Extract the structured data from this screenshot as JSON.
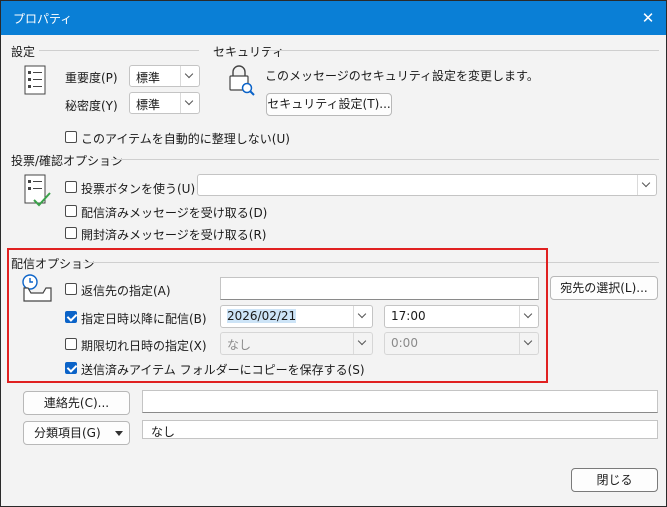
{
  "window": {
    "title": "プロパティ",
    "close_glyph": "✕"
  },
  "settings": {
    "heading": "設定",
    "importance_label": "重要度(P)",
    "importance_value": "標準",
    "sensitivity_label": "秘密度(Y)",
    "sensitivity_value": "標準",
    "do_not_autoarchive": "このアイテムを自動的に整理しない(U)"
  },
  "security": {
    "heading": "セキュリティ",
    "description": "このメッセージのセキュリティ設定を変更します。",
    "button": "セキュリティ設定(T)..."
  },
  "voting": {
    "heading": "投票/確認オプション",
    "use_voting": "投票ボタンを使う(U)",
    "voting_value": "",
    "delivery_receipt": "配信済みメッセージを受け取る(D)",
    "read_receipt": "開封済みメッセージを受け取る(R)"
  },
  "delivery": {
    "heading": "配信オプション",
    "reply_to_label": "返信先の指定(A)",
    "reply_to_value": "",
    "select_names_button": "宛先の選択(L)...",
    "do_not_deliver_label": "指定日時以降に配信(B)",
    "deliver_date": "2026/02/21",
    "deliver_time": "17:00",
    "expires_label": "期限切れ日時の指定(X)",
    "expires_date": "なし",
    "expires_time": "0:00",
    "save_copy_label": "送信済みアイテム フォルダーにコピーを保存する(S)"
  },
  "contacts": {
    "button": "連絡先(C)...",
    "value": ""
  },
  "categories": {
    "button": "分類項目(G)",
    "value": "なし"
  },
  "footer": {
    "close_button": "閉じる"
  },
  "colors": {
    "titlebar": "#0a7fd6",
    "highlight_border": "#e02020",
    "checkbox_checked": "#0b63c8"
  }
}
